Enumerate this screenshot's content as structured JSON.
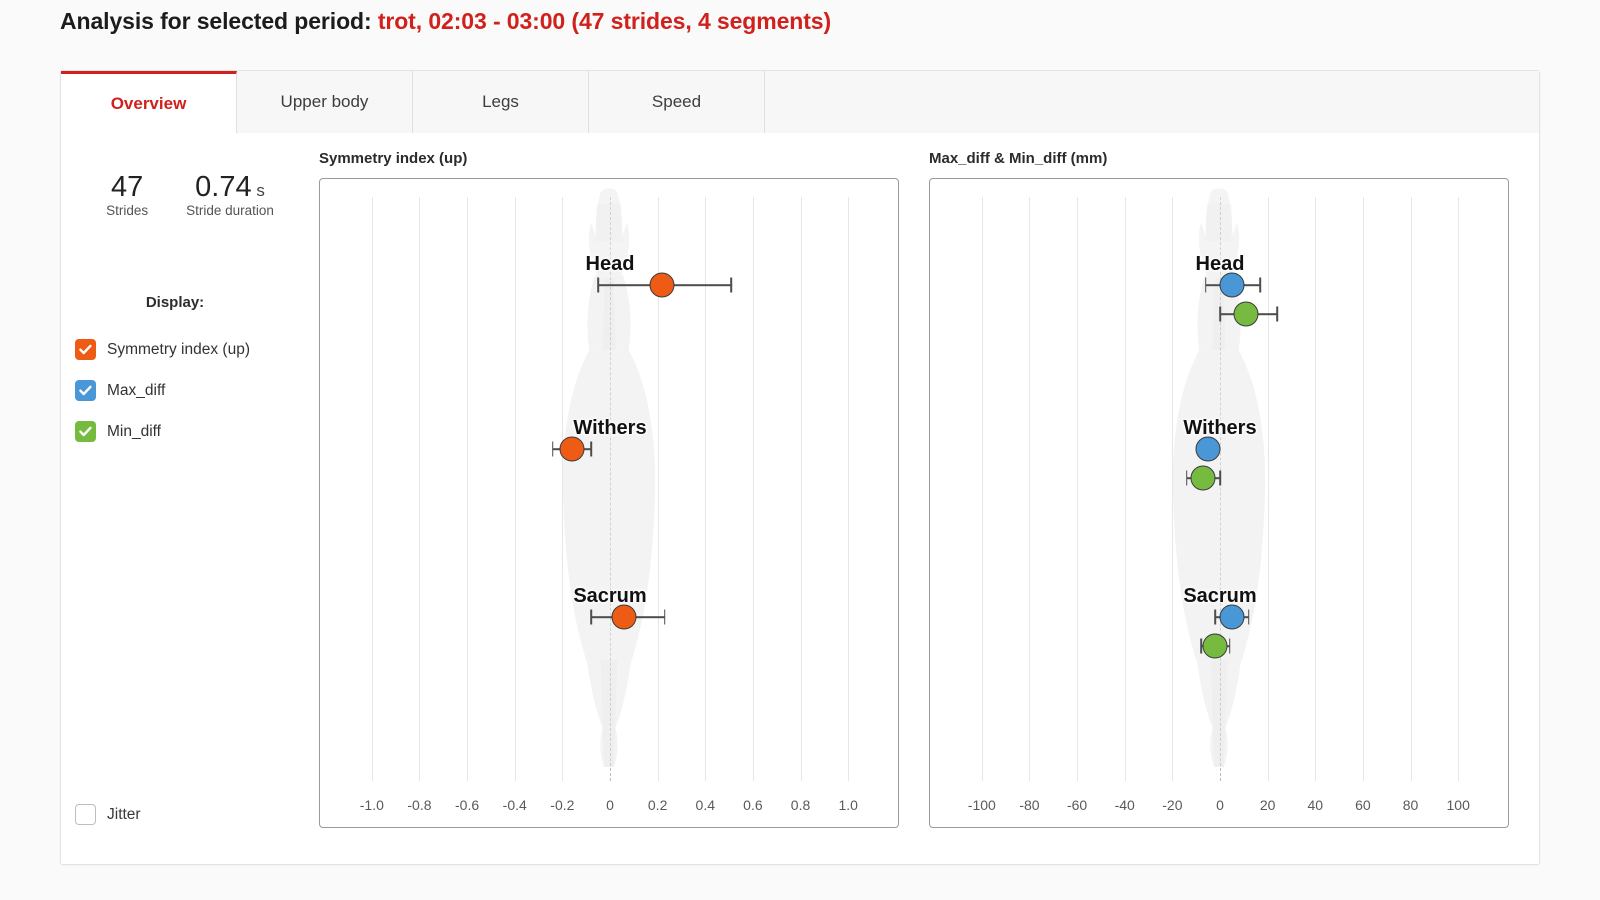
{
  "header": {
    "prefix": "Analysis for selected period:",
    "period": "trot, 02:03 - 03:00 (47 strides, 4 segments)",
    "accent_color": "#d0211c"
  },
  "tabs": [
    {
      "label": "Overview",
      "active": true
    },
    {
      "label": "Upper body",
      "active": false
    },
    {
      "label": "Legs",
      "active": false
    },
    {
      "label": "Speed",
      "active": false
    }
  ],
  "sidebar": {
    "stats": [
      {
        "value": "47",
        "unit": "",
        "label": "Strides"
      },
      {
        "value": "0.74",
        "unit": "s",
        "label": "Stride duration"
      }
    ],
    "display_title": "Display:",
    "legend": [
      {
        "label": "Symmetry index (up)",
        "color": "#ee5b15",
        "checked": true
      },
      {
        "label": "Max_diff",
        "color": "#4a97d8",
        "checked": true
      },
      {
        "label": "Min_diff",
        "color": "#76bb40",
        "checked": true
      }
    ],
    "jitter": {
      "label": "Jitter",
      "checked": false
    }
  },
  "chart_data": [
    {
      "type": "scatter",
      "id": "symmetry-index",
      "title": "Symmetry index (up)",
      "xlabel": "",
      "ylabel": "",
      "xlim": [
        -1.1,
        1.1
      ],
      "ticks": [
        "-1.0",
        "-0.8",
        "-0.6",
        "-0.4",
        "-0.2",
        "0",
        "0.2",
        "0.4",
        "0.6",
        "0.8",
        "1.0"
      ],
      "tick_values": [
        -1.0,
        -0.8,
        -0.6,
        -0.4,
        -0.2,
        0,
        0.2,
        0.4,
        0.6,
        0.8,
        1.0
      ],
      "grid": true,
      "zero_reference": 0,
      "legend_position": "external-left",
      "groups": [
        "Head",
        "Withers",
        "Sacrum"
      ],
      "series": [
        {
          "name": "Symmetry index (up)",
          "color": "#ee5b15",
          "points": [
            {
              "group": "Head",
              "value": 0.22,
              "low": -0.05,
              "high": 0.51
            },
            {
              "group": "Withers",
              "value": -0.16,
              "low": -0.24,
              "high": -0.08
            },
            {
              "group": "Sacrum",
              "value": 0.06,
              "low": -0.08,
              "high": 0.23
            }
          ]
        }
      ]
    },
    {
      "type": "scatter",
      "id": "maxdiff-mindiff",
      "title": "Max_diff & Min_diff (mm)",
      "xlabel": "mm",
      "ylabel": "",
      "xlim": [
        -110,
        110
      ],
      "ticks": [
        "-100",
        "-80",
        "-60",
        "-40",
        "-20",
        "0",
        "20",
        "40",
        "60",
        "80",
        "100"
      ],
      "tick_values": [
        -100,
        -80,
        -60,
        -40,
        -20,
        0,
        20,
        40,
        60,
        80,
        100
      ],
      "grid": true,
      "zero_reference": 0,
      "legend_position": "external-left",
      "groups": [
        "Head",
        "Withers",
        "Sacrum"
      ],
      "series": [
        {
          "name": "Max_diff",
          "color": "#4a97d8",
          "points": [
            {
              "group": "Head",
              "value": 5,
              "low": -6,
              "high": 17
            },
            {
              "group": "Withers",
              "value": -5,
              "low": -8,
              "high": -2
            },
            {
              "group": "Sacrum",
              "value": 5,
              "low": -2,
              "high": 12
            }
          ]
        },
        {
          "name": "Min_diff",
          "color": "#76bb40",
          "points": [
            {
              "group": "Head",
              "value": 11,
              "low": 0,
              "high": 24
            },
            {
              "group": "Withers",
              "value": -7,
              "low": -14,
              "high": 0
            },
            {
              "group": "Sacrum",
              "value": -2,
              "low": -8,
              "high": 4
            }
          ]
        }
      ]
    }
  ]
}
